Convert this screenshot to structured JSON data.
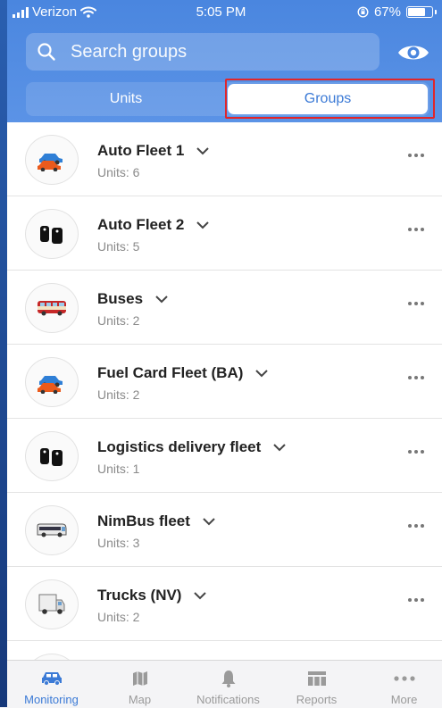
{
  "status_bar": {
    "carrier": "Verizon",
    "time": "5:05 PM",
    "battery_percent": "67%",
    "battery_level": 0.67
  },
  "search": {
    "placeholder": "Search groups"
  },
  "segments": {
    "units_label": "Units",
    "groups_label": "Groups",
    "selected": "Groups"
  },
  "groups": [
    {
      "name": "Auto Fleet 1",
      "units": "Units: 6",
      "icon": "cars-icon"
    },
    {
      "name": "Auto Fleet 2",
      "units": "Units: 5",
      "icon": "tags-icon"
    },
    {
      "name": "Buses",
      "units": "Units: 2",
      "icon": "bus-icon"
    },
    {
      "name": "Fuel Card Fleet (BA)",
      "units": "Units: 2",
      "icon": "cars-icon"
    },
    {
      "name": "Logistics delivery fleet",
      "units": "Units: 1",
      "icon": "tags-icon"
    },
    {
      "name": "NimBus fleet",
      "units": "Units: 3",
      "icon": "coach-icon"
    },
    {
      "name": "Trucks (NV)",
      "units": "Units: 2",
      "icon": "truck-icon"
    }
  ],
  "tabbar": {
    "items": [
      {
        "label": "Monitoring",
        "icon": "car-icon",
        "active": true
      },
      {
        "label": "Map",
        "icon": "map-icon",
        "active": false
      },
      {
        "label": "Notifications",
        "icon": "bell-icon",
        "active": false
      },
      {
        "label": "Reports",
        "icon": "table-icon",
        "active": false
      },
      {
        "label": "More",
        "icon": "ellipsis-icon",
        "active": false
      }
    ]
  },
  "colors": {
    "header": "#4a86df",
    "accent": "#3b7ad6",
    "highlight_box": "#e0262a"
  }
}
